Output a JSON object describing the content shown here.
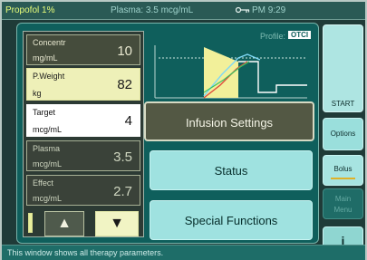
{
  "topbar": {
    "drug": "Propofol 1%",
    "plasma": "Plasma: 3.5 mcg/mL",
    "clock": "PM 9:29"
  },
  "profile": {
    "label": "Profile:",
    "badge": "OTCI"
  },
  "params": [
    {
      "name": "Concentr",
      "unit": "mg/mL",
      "value": "10"
    },
    {
      "name": "P.Weight",
      "unit": "kg",
      "value": "82"
    },
    {
      "name": "Target",
      "unit": "mcg/mL",
      "value": "4"
    },
    {
      "name": "Plasma",
      "unit": "mcg/mL",
      "value": "3.5"
    },
    {
      "name": "Effect",
      "unit": "mcg/mL",
      "value": "2.7"
    }
  ],
  "menu": {
    "infusion": "Infusion Settings",
    "status": "Status",
    "special": "Special Functions"
  },
  "right": {
    "start": "START",
    "options": "Options",
    "bolus": "Bolus",
    "main_menu_1": "Main",
    "main_menu_2": "Menu",
    "info": "i"
  },
  "statusbar": "This window shows all therapy parameters.",
  "colors": {
    "background": "#1f3b38",
    "main_panel": "#0f5f5c",
    "accent_yellow": "#e9ff7a",
    "button_cyan": "#9fe2e0",
    "selected_param": "#ffffff",
    "highlight_param": "#eef0b8",
    "bolus_underline": "#e0b128"
  },
  "icons": {
    "key": "key-icon",
    "up": "arrow-up-icon",
    "down": "arrow-down-icon",
    "info": "info-icon"
  }
}
